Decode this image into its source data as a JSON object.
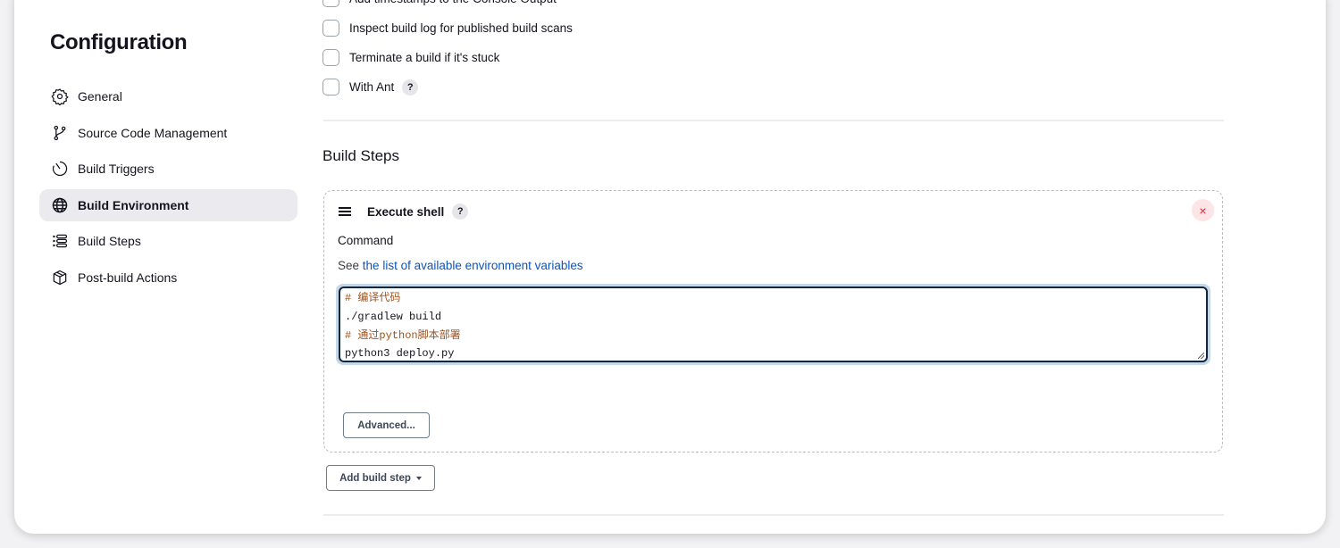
{
  "page": {
    "title": "Configuration"
  },
  "sidebar": {
    "items": [
      {
        "label": "General",
        "icon": "gear-icon",
        "active": false
      },
      {
        "label": "Source Code Management",
        "icon": "git-branch-icon",
        "active": false
      },
      {
        "label": "Build Triggers",
        "icon": "timer-icon",
        "active": false
      },
      {
        "label": "Build Environment",
        "icon": "globe-icon",
        "active": true
      },
      {
        "label": "Build Steps",
        "icon": "list-icon",
        "active": false
      },
      {
        "label": "Post-build Actions",
        "icon": "package-icon",
        "active": false
      }
    ]
  },
  "build_environment": {
    "options": [
      {
        "label": "Add timestamps to the Console Output",
        "checked": false
      },
      {
        "label": "Inspect build log for published build scans",
        "checked": false
      },
      {
        "label": "Terminate a build if it's stuck",
        "checked": false
      },
      {
        "label": "With Ant",
        "checked": false,
        "help": "?"
      }
    ]
  },
  "build_steps": {
    "title": "Build Steps",
    "step": {
      "name": "Execute shell",
      "help": "?",
      "close": "×",
      "command_label": "Command",
      "see_prefix": "See",
      "env_link": "the list of available environment variables",
      "command_lines": [
        {
          "text": "# 编译代码",
          "comment": true
        },
        {
          "text": "./gradlew build",
          "comment": false
        },
        {
          "text": "# 通过python脚本部署",
          "comment": true
        },
        {
          "text": "python3 deploy.py",
          "comment": false
        }
      ],
      "advanced_label": "Advanced..."
    },
    "add_step_label": "Add build step"
  }
}
